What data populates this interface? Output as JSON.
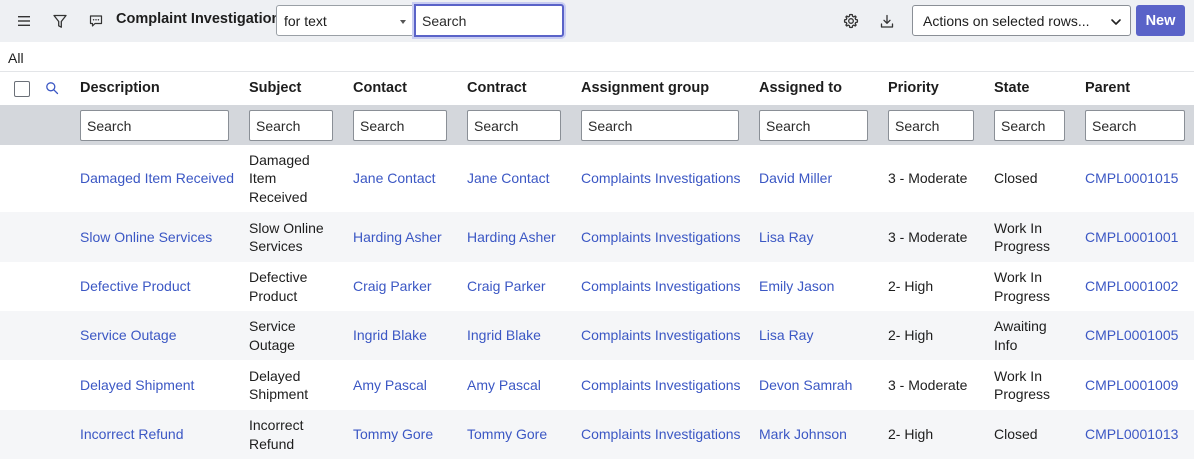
{
  "toolbar": {
    "title": "Complaint Investigations",
    "search_field_option": "for text",
    "search_placeholder": "Search",
    "actions_label": "Actions on selected rows...",
    "new_label": "New"
  },
  "breadcrumb": {
    "all_label": "All"
  },
  "columns": [
    {
      "label": "Description",
      "search_placeholder": "Search"
    },
    {
      "label": "Subject",
      "search_placeholder": "Search"
    },
    {
      "label": "Contact",
      "search_placeholder": "Search"
    },
    {
      "label": "Contract",
      "search_placeholder": "Search"
    },
    {
      "label": "Assignment group",
      "search_placeholder": "Search"
    },
    {
      "label": "Assigned to",
      "search_placeholder": "Search"
    },
    {
      "label": "Priority",
      "search_placeholder": "Search"
    },
    {
      "label": "State",
      "search_placeholder": "Search"
    },
    {
      "label": "Parent",
      "search_placeholder": "Search"
    }
  ],
  "rows": [
    {
      "description": "Damaged Item Received",
      "subject": [
        "Damaged",
        "Item",
        "Received"
      ],
      "contact": "Jane Contact",
      "contract": "Jane Contact",
      "assignment_group": "Complaints Investigations",
      "assigned_to": "David Miller",
      "priority": "3 - Moderate",
      "state": [
        "Closed"
      ],
      "parent": "CMPL0001015"
    },
    {
      "description": "Slow Online Services",
      "subject": [
        "Slow Online",
        "Services"
      ],
      "contact": "Harding Asher",
      "contract": "Harding Asher",
      "assignment_group": "Complaints Investigations",
      "assigned_to": "Lisa Ray",
      "priority": "3 - Moderate",
      "state": [
        "Work In",
        "Progress"
      ],
      "parent": "CMPL0001001"
    },
    {
      "description": "Defective Product",
      "subject": [
        "Defective",
        "Product"
      ],
      "contact": "Craig Parker",
      "contract": "Craig Parker",
      "assignment_group": "Complaints Investigations",
      "assigned_to": "Emily Jason",
      "priority": "2- High",
      "state": [
        "Work In",
        "Progress"
      ],
      "parent": "CMPL0001002"
    },
    {
      "description": "Service Outage",
      "subject": [
        "Service",
        "Outage"
      ],
      "contact": "Ingrid Blake",
      "contract": "Ingrid Blake",
      "assignment_group": "Complaints Investigations",
      "assigned_to": "Lisa Ray",
      "priority": "2- High",
      "state": [
        "Awaiting",
        "Info"
      ],
      "parent": "CMPL0001005"
    },
    {
      "description": "Delayed Shipment",
      "subject": [
        "Delayed",
        "Shipment"
      ],
      "contact": "Amy Pascal",
      "contract": "Amy Pascal",
      "assignment_group": "Complaints Investigations",
      "assigned_to": "Devon Samrah",
      "priority": "3 - Moderate",
      "state": [
        "Work In",
        "Progress"
      ],
      "parent": "CMPL0001009"
    },
    {
      "description": "Incorrect Refund",
      "subject": [
        "Incorrect",
        "Refund"
      ],
      "contact": "Tommy Gore",
      "contract": "Tommy Gore",
      "assignment_group": "Complaints Investigations",
      "assigned_to": "Mark Johnson",
      "priority": "2- High",
      "state": [
        "Closed"
      ],
      "parent": "CMPL0001013"
    }
  ],
  "icons": {
    "menu": "hamburger-menu-icon",
    "filter": "filter-funnel-icon",
    "comment": "comment-bubble-icon",
    "settings": "gear-icon",
    "download": "download-icon",
    "column_search": "search-icon"
  },
  "colors": {
    "accent": "#5a63c8",
    "link": "#3b57c4",
    "toolbar_bg": "#eef0f3",
    "filter_row_bg": "#d4d7dc"
  }
}
